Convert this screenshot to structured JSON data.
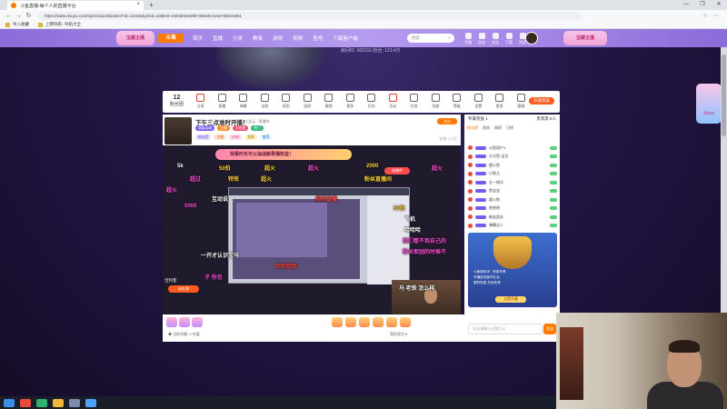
{
  "browser": {
    "tab_title": "斗鱼直播-每个人的直播平台",
    "tab_close": "×",
    "new_tab": "+",
    "window_controls": [
      "—",
      "❐",
      "✕"
    ],
    "nav": {
      "back": "←",
      "forward": "→",
      "reload": "↻"
    },
    "url": "https://www.douyu.com/topic/xiaoshijianlei?rid=1216&dyshid=1b5bc8-c0e0d032a8f67360e5c4c6e7d5031951",
    "bookmarks": [
      "导入收藏",
      "上网导航--导航大全"
    ],
    "addr_icons": [
      "☆",
      "⋯"
    ]
  },
  "site": {
    "banner_left": "宝藏主播",
    "logo": "斗鱼",
    "nav": [
      "首页",
      "直播",
      "分类",
      "赛事",
      "游戏",
      "视频",
      "鱼吧",
      "下载客户端"
    ],
    "search_placeholder": "搜索",
    "header_icons": [
      "开播",
      "历史",
      "关注",
      "下载",
      "消息"
    ],
    "banner_right": "宝藏主播"
  },
  "room": {
    "stats": "房间ID: 000116    粉丝: 123.4万"
  },
  "toolbar": {
    "count_value": "12",
    "count_label": "粉丝团",
    "items": [
      "分享",
      "直播",
      "弹幕",
      "全屏",
      "网页",
      "画质",
      "截图",
      "更多",
      "礼包",
      "活动",
      "任务",
      "贡献",
      "等级",
      "设置",
      "更多",
      "客服"
    ],
    "cta": "开通贵族"
  },
  "stream": {
    "title": "下午三点准时开播！",
    "subtitle": "分区: 二次元 · 直播中",
    "tags": [
      "超级英雄",
      "主播",
      "大明星",
      "热门"
    ],
    "badges": [
      "粉丝团",
      "主播",
      "VIP5",
      "直播",
      "推荐"
    ],
    "follow": "关注",
    "meta": "在线: 3.2万",
    "gift_banner": "观看时长可以抽战舰录播权益！",
    "live_badge": "直播中",
    "gift_user": "宝利客",
    "gift_button": "送礼物",
    "danmaku": [
      "观看时长可以抽战舰录播权益！",
      "5k",
      "50伯",
      "超火",
      "超火",
      "2000",
      "超火",
      "超过",
      "特效",
      "超火",
      "粉丝直播间",
      "超火",
      "50伯",
      "5000",
      "飞机",
      "哈哈哈",
      "我们看不到自己的",
      "粉丝家园的时候不",
      "一开才认识宝马",
      "子 你也",
      "马 老铁 怎么样",
      "哈哈哈哈",
      "互动说",
      "视频直播"
    ]
  },
  "giftbar": {
    "left_text": "◆ 当前余额: 0  充值",
    "right_text": "我的背包  ▾"
  },
  "chat": {
    "top_left": "专属贵族 1",
    "top_right": "贵宾席 8人",
    "tabs": [
      "粉丝榜",
      "贵宾",
      "周榜",
      "日榜"
    ],
    "fans": [
      "斗鱼用户1",
      "大大鱼-宝贝",
      "超火鱼",
      "小鱼儿",
      "五一快乐",
      "鱼宝宝",
      "超火啦",
      "哈哈哈",
      "粉丝团长",
      "弹幕达人"
    ],
    "promo_lines": [
      "斗鱼周年庆 · 贵族专享",
      "开通即送豪华礼包",
      "限时特惠  先到先得"
    ],
    "promo_button": "立即开通",
    "input_placeholder": "发送弹幕与主播互动",
    "send": "发送"
  },
  "side_widget": "周年庆",
  "taskbar": [
    "start",
    "browser",
    "chat",
    "folder",
    "settings",
    "store"
  ]
}
